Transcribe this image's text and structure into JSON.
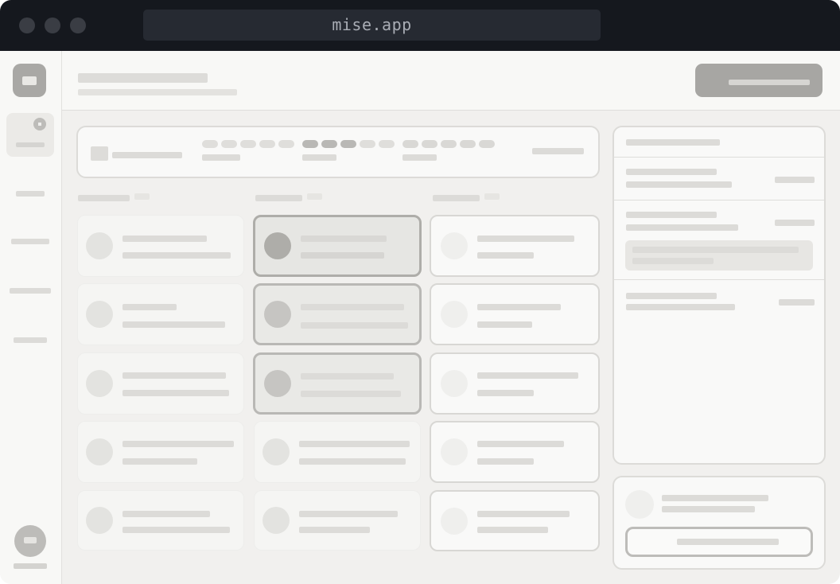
{
  "window": {
    "url": "mise.app"
  },
  "colors": {
    "titlebar": "#15181e",
    "url_field": "#262a32",
    "primary_button": "#a7a6a3",
    "canvas": "#f1f0ee",
    "selected_card_border": "#b9b8b5"
  },
  "sidebar": {
    "items": [
      "home-icon",
      "nav-item",
      "nav-item",
      "nav-item",
      "nav-item"
    ]
  },
  "board": {
    "columns": 3,
    "selected_column": 2,
    "selected_cards": 3
  },
  "filter": {
    "active_pill_group": 2
  }
}
